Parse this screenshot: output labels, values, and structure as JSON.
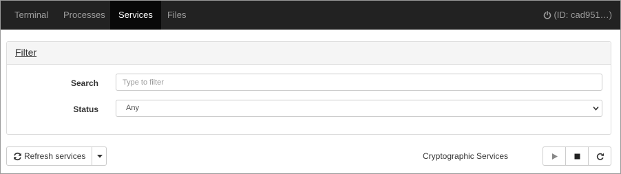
{
  "nav": {
    "tabs": [
      {
        "label": "Terminal",
        "active": false
      },
      {
        "label": "Processes",
        "active": false
      },
      {
        "label": "Services",
        "active": true
      },
      {
        "label": "Files",
        "active": false
      }
    ],
    "session_label": "(ID: cad951…)",
    "session_icon": "power-icon"
  },
  "filter": {
    "title": "Filter",
    "search_label": "Search",
    "search_placeholder": "Type to filter",
    "search_value": "",
    "status_label": "Status",
    "status_value": "Any"
  },
  "toolbar": {
    "refresh_label": "Refresh services",
    "refresh_icon": "refresh-icon",
    "selected_service": "Cryptographic Services",
    "start_icon": "play-icon",
    "stop_icon": "stop-icon",
    "restart_icon": "restart-icon"
  },
  "colors": {
    "navbar_bg": "#222222",
    "active_tab_bg": "#080808",
    "panel_heading_bg": "#f5f5f5"
  }
}
